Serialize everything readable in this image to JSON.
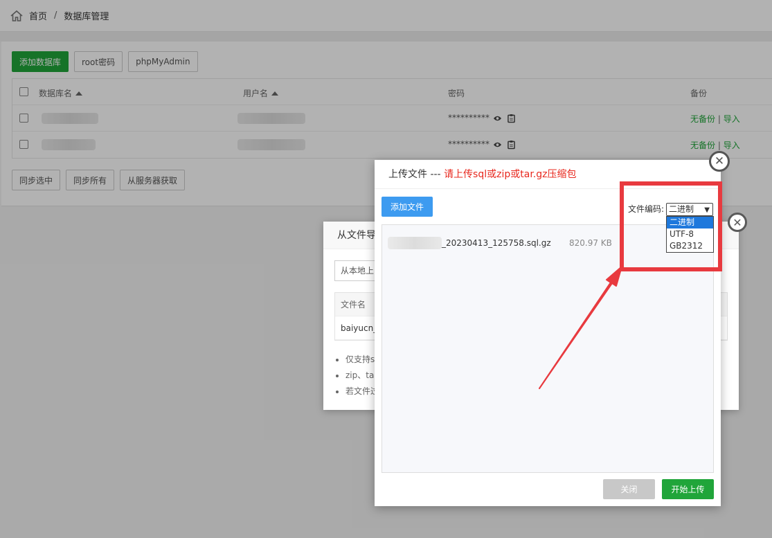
{
  "breadcrumb": {
    "home": "首页",
    "separator": "/",
    "current": "数据库管理"
  },
  "toolbar": {
    "add_db": "添加数据库",
    "root_pwd": "root密码",
    "phpmyadmin": "phpMyAdmin"
  },
  "table": {
    "headers": {
      "name": "数据库名",
      "user": "用户名",
      "password": "密码",
      "backup": "备份"
    },
    "rows": [
      {
        "password": "**********",
        "backup_status": "无备份",
        "divider": "|",
        "import": "导入"
      },
      {
        "password": "**********",
        "backup_status": "无备份",
        "divider": "|",
        "import": "导入"
      }
    ]
  },
  "bottom_buttons": {
    "sync_selected": "同步选中",
    "sync_all": "同步所有",
    "fetch_server": "从服务器获取"
  },
  "import_dialog": {
    "title": "从文件导",
    "source_button": "从本地上",
    "file_header": "文件名",
    "file_row": "baiyucn_",
    "notes": [
      "仅支持s",
      "zip、tar",
      "若文件过"
    ]
  },
  "upload_dialog": {
    "title_prefix": "上传文件 --- ",
    "title_hint": "请上传sql或zip或tar.gz压缩包",
    "add_file": "添加文件",
    "encoding_label": "文件编码:",
    "encoding_selected": "二进制",
    "encoding_options": [
      "二进制",
      "UTF-8",
      "GB2312"
    ],
    "file_name_suffix": "_20230413_125758.sql.gz",
    "file_size": "820.97 KB",
    "close_button": "关闭",
    "start_button": "开始上传"
  },
  "colors": {
    "accent_green": "#20a53a",
    "accent_blue": "#3d9bf0",
    "annotation_red": "#e83a3f",
    "hint_red": "#e8281e"
  }
}
